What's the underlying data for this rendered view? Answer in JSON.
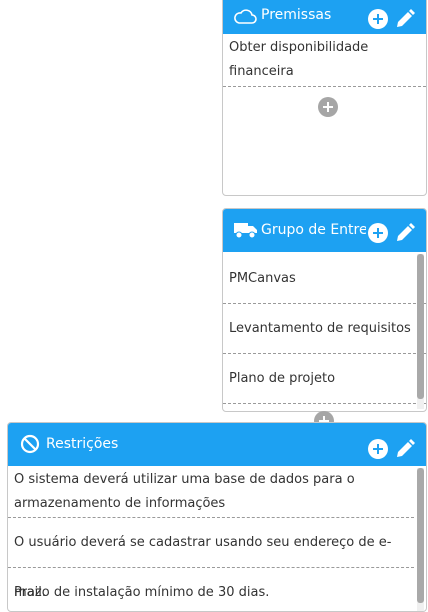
{
  "premissas": {
    "title": "Premissas",
    "header_icon": "cloud-icon",
    "items": [
      {
        "text": "Obter disponibilidade financeira"
      }
    ]
  },
  "entregas": {
    "title": "Grupo de Entregas",
    "header_icon": "truck-icon",
    "items": [
      {
        "text": "PMCanvas"
      },
      {
        "text": "Levantamento de requisitos"
      },
      {
        "text": "Plano de projeto"
      }
    ]
  },
  "restricoes": {
    "title": "Restrições",
    "header_icon": "ban-icon",
    "items": [
      {
        "text": "O sistema deverá utilizar uma base de dados para o armazenamento de informações"
      },
      {
        "text": "O usuário deverá se cadastrar usando seu endereço de e-mail."
      },
      {
        "text": "Prazo de instalação mínimo de 30 dias."
      }
    ]
  },
  "colors": {
    "header": "#1da1f2",
    "add_button": "#a6a6a6"
  }
}
